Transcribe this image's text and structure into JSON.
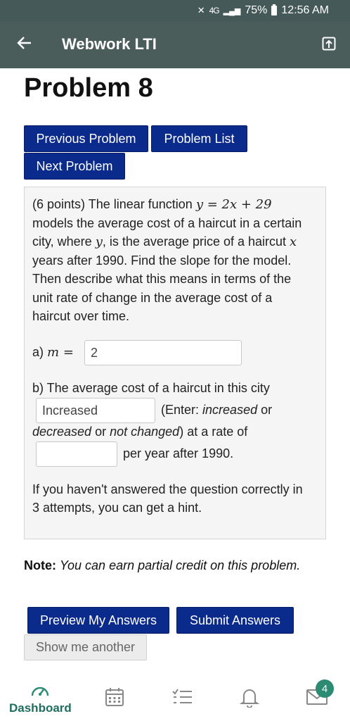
{
  "status_bar": {
    "signal": "4G",
    "battery": "75%",
    "time": "12:56 AM"
  },
  "app_bar": {
    "title": "Webwork LTI"
  },
  "page": {
    "title": "Problem 8"
  },
  "nav_buttons": {
    "previous": "Previous Problem",
    "list": "Problem List",
    "next": "Next Problem"
  },
  "problem": {
    "points": "(6 points) The linear function",
    "equation": "y = 2x + 29",
    "line2": "models the average cost of a haircut in a certain",
    "line3_a": "city, where",
    "var_y": "y",
    "line3_b": ", is the average price of a haircut",
    "var_x": "x",
    "line4": "years after 1990. Find the slope for the model.",
    "line5": "Then describe what this means in terms of the",
    "line6": "unit rate of change in the average cost of a",
    "line7": "haircut over time.",
    "part_a_label": "a)",
    "part_a_eq": "m =",
    "part_a_value": "2",
    "part_b_text": "b) The average cost of a haircut in this city",
    "part_b_value": "Increased",
    "enter_prefix": "(Enter:",
    "opt_increased": "increased",
    "or_word": "or",
    "opt_decreased": "decreased",
    "or_word2": "or",
    "opt_not_changed": "not changed",
    "rate_suffix": ") at a rate of",
    "rate_value": "",
    "per_year": "per year after 1990.",
    "hint_line1": "If you haven't answered the question correctly in",
    "hint_line2": "3 attempts, you can get a hint."
  },
  "note": {
    "label": "Note:",
    "text": "You can earn partial credit on this problem."
  },
  "actions": {
    "preview": "Preview My Answers",
    "submit": "Submit Answers",
    "show_another": "Show me another"
  },
  "bottom_nav": {
    "dashboard": "Dashboard",
    "badge_count": "4"
  },
  "colors": {
    "app_bar": "#4a5d5b",
    "button_blue": "#0a2a8c",
    "accent_green": "#2c8b72"
  }
}
